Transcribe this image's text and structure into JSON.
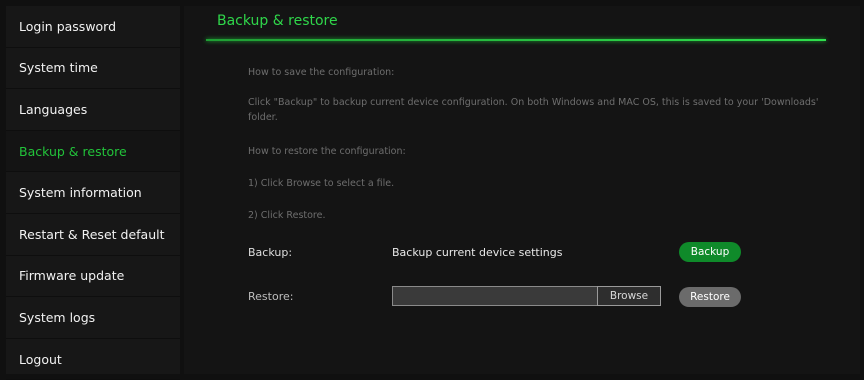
{
  "sidebar": {
    "items": [
      {
        "label": "Login password"
      },
      {
        "label": "System time"
      },
      {
        "label": "Languages"
      },
      {
        "label": "Backup & restore"
      },
      {
        "label": "System information"
      },
      {
        "label": "Restart & Reset default"
      },
      {
        "label": "Firmware update"
      },
      {
        "label": "System logs"
      },
      {
        "label": "Logout"
      }
    ],
    "active_index": 3
  },
  "main": {
    "title": "Backup & restore",
    "notes": [
      "How to save the configuration:",
      "Click \"Backup\" to backup current device configuration. On both Windows and MAC OS, this is saved to your 'Downloads' folder.",
      "How to restore the configuration:",
      "1) Click Browse to select a file.",
      "2) Click Restore."
    ],
    "backup": {
      "label": "Backup:",
      "description": "Backup current device settings",
      "button": "Backup"
    },
    "restore": {
      "label": "Restore:",
      "file_value": "",
      "browse_button": "Browse",
      "button": "Restore"
    }
  },
  "colors": {
    "accent": "#22c33a",
    "backup_button": "#0f8a2a",
    "restore_button": "#6b6b6b"
  }
}
